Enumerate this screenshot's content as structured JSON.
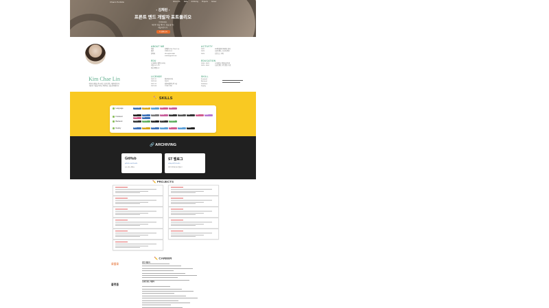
{
  "hero": {
    "brand": "Chae's Portfolio",
    "nav": [
      "About me",
      "Skills",
      "Archiving",
      "Projects",
      "Career"
    ],
    "tagline": "- 김채린 -",
    "title": "프론트 엔드 개발자 포트폴리오",
    "desc_lines": [
      "안녕하세요.",
      "새로운 것을 배우는 것을 즐기는",
      "개발자입니다."
    ],
    "more_label": "더 알아보기"
  },
  "about": {
    "name": "Kim Chae Lin",
    "intro_lines": [
      "사용자 경험을 중시하는 프론트엔드 개발자입니다.",
      "새로운 기술을 익히고 적용하는 것을 좋아합니다."
    ],
    "about_me_title": "ABOUT ME",
    "about_me": [
      {
        "k": "이름",
        "v": "김채린 (Kim Chae Lin)"
      },
      {
        "k": "생년",
        "v": "1999.01.01"
      },
      {
        "k": "연락처",
        "v": "010-0000-0000"
      },
      {
        "k": "",
        "v": "email@gmail.com"
      }
    ],
    "activity_title": "ACTIVITY",
    "activity": [
      {
        "k": "2022",
        "v": "SW중심대학 해커톤 참가"
      },
      {
        "k": "2023",
        "v": "프론트엔드 스터디 운영"
      },
      {
        "k": "2023",
        "v": "오픈소스 기여"
      }
    ],
    "education_title": "EDUCATION",
    "education": [
      {
        "k": "2018 - 2023",
        "v": "OO대학교 컴퓨터공학과"
      },
      {
        "k": "2023 - 2024",
        "v": "프론트엔드 부트캠프 수료"
      }
    ],
    "edu2_title": "EDU",
    "edu2": [
      {
        "k": "",
        "v": "OO대학교 졸업 (2023)"
      },
      {
        "k": "",
        "v": "학점 4.0 / 4.5"
      },
      {
        "k": "",
        "v": "전공 평점 4.2"
      }
    ],
    "license_title": "LICENSE",
    "license": [
      {
        "k": "2022.11",
        "v": "정보처리기사"
      },
      {
        "k": "2022.06",
        "v": "SQLD"
      },
      {
        "k": "2021.12",
        "v": "컴퓨터활용능력 1급"
      },
      {
        "k": "2021.08",
        "v": "TOEIC 850"
      }
    ],
    "skill_title": "SKILL",
    "skill_items": [
      "Frontend",
      "Backend",
      "Database",
      "Deploy"
    ]
  },
  "skills": {
    "title": "✏️ SKILLS",
    "rows": [
      {
        "label": "Language",
        "badges": [
          {
            "t": "JavaScript",
            "c": "#3b6fb6"
          },
          {
            "t": "TypeScript",
            "c": "#d4a21a"
          },
          {
            "t": "HTML",
            "c": "#5a9ed6"
          },
          {
            "t": "CSS",
            "c": "#d05a8c"
          },
          {
            "t": "Java",
            "c": "#c75d9a"
          }
        ]
      },
      {
        "label": "Frontend",
        "badges": [
          {
            "t": "React",
            "c": "#222"
          },
          {
            "t": "Next.js",
            "c": "#3b6fb6"
          },
          {
            "t": "Redux",
            "c": "#777"
          },
          {
            "t": "Recoil",
            "c": "#c75d9a"
          },
          {
            "t": "Styled",
            "c": "#333"
          },
          {
            "t": "Tailwind",
            "c": "#555"
          },
          {
            "t": "Sass",
            "c": "#333"
          },
          {
            "t": "MUI",
            "c": "#d05a8c"
          },
          {
            "t": "Axios",
            "c": "#b678d4"
          },
          {
            "t": "Query",
            "c": "#d05a8c"
          },
          {
            "t": "Vite",
            "c": "#3b6fb6"
          }
        ]
      },
      {
        "label": "Backend",
        "badges": [
          {
            "t": "Node.js",
            "c": "#333"
          },
          {
            "t": "Express",
            "c": "#5fae5f"
          },
          {
            "t": "Spring",
            "c": "#222"
          },
          {
            "t": "MySQL",
            "c": "#333"
          },
          {
            "t": "MongoDB",
            "c": "#5fae5f"
          }
        ]
      },
      {
        "label": "Deploy",
        "badges": [
          {
            "t": "AWS",
            "c": "#3b6fb6"
          },
          {
            "t": "Netlify",
            "c": "#d4a21a"
          },
          {
            "t": "Vercel",
            "c": "#3b6fb6"
          },
          {
            "t": "Docker",
            "c": "#5a9ed6"
          },
          {
            "t": "Git",
            "c": "#d05a8c"
          },
          {
            "t": "GitHub",
            "c": "#5a9ed6"
          },
          {
            "t": "Notion",
            "c": "#222"
          }
        ]
      }
    ]
  },
  "archiving": {
    "title": "🔗 ARCHIVING",
    "cards": [
      {
        "logo": "GitHub",
        "url": "github.com/chaelin",
        "desc": "소스 코드 저장소"
      },
      {
        "logo": "ST 벨로그",
        "url": "velog.io/@chaelin",
        "desc": "공부 기록 및 회고 블로그"
      }
    ]
  },
  "projects": {
    "title": "✏️ PROJECTS"
  },
  "career": {
    "title": "✏️ CAREER",
    "logos": [
      {
        "t": "오잉오",
        "c": "#e46b2b"
      },
      {
        "t": "플랫폼",
        "c": "#333"
      }
    ],
    "heads": [
      "인턴 개발자",
      "프론트엔드 개발자"
    ]
  }
}
